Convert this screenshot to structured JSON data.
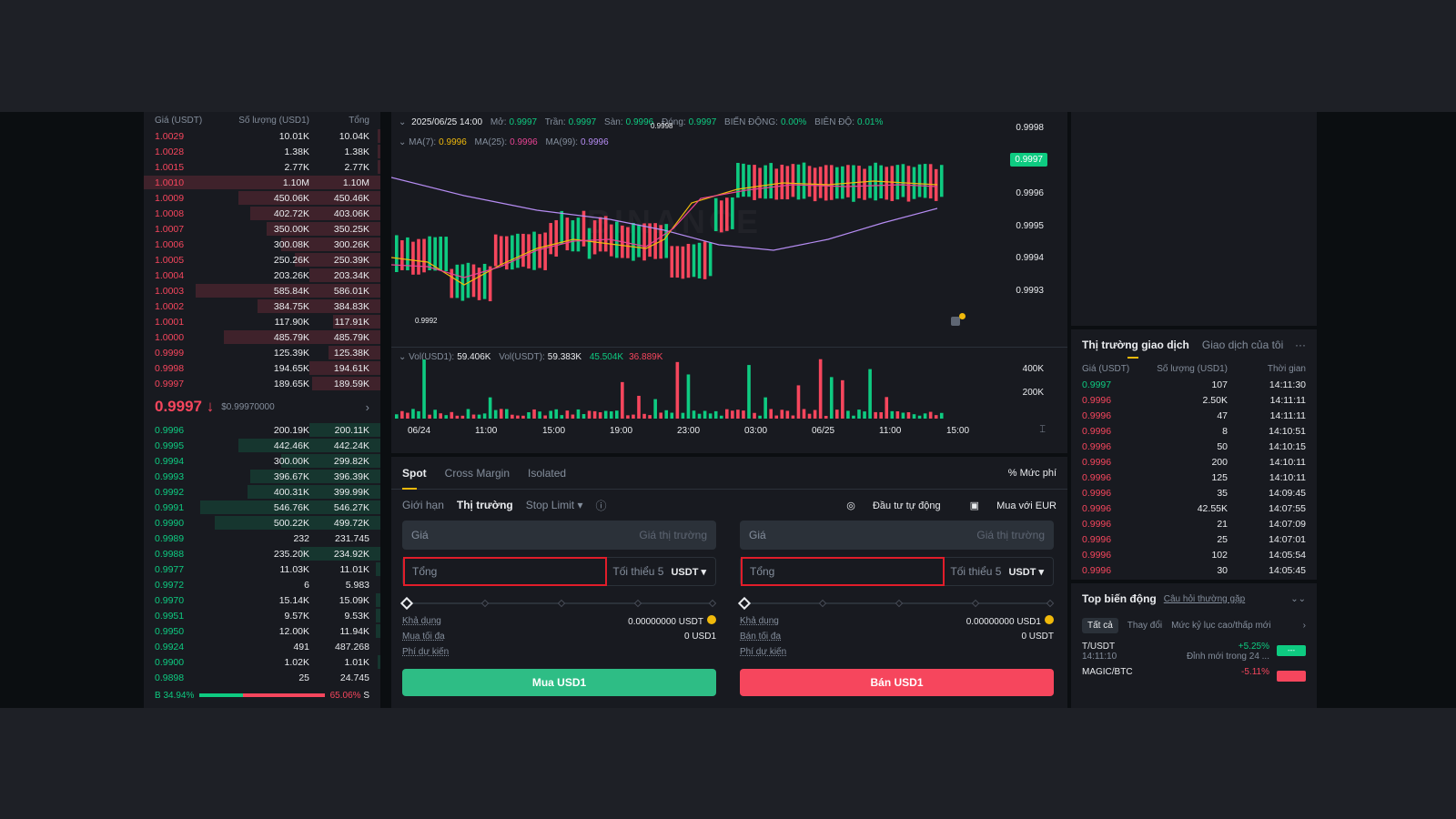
{
  "orderbook": {
    "headers": {
      "price": "Giá (USDT)",
      "qty": "Số lượng (USD1)",
      "total": "Tổng"
    },
    "asks": [
      {
        "p": "1.0029",
        "q": "10.01K",
        "t": "10.04K",
        "d": 0.01
      },
      {
        "p": "1.0028",
        "q": "1.38K",
        "t": "1.38K",
        "d": 0.01
      },
      {
        "p": "1.0015",
        "q": "2.77K",
        "t": "2.77K",
        "d": 0.01
      },
      {
        "p": "1.0010",
        "q": "1.10M",
        "t": "1.10M",
        "d": 1.0
      },
      {
        "p": "1.0009",
        "q": "450.06K",
        "t": "450.46K",
        "d": 0.6
      },
      {
        "p": "1.0008",
        "q": "402.72K",
        "t": "403.06K",
        "d": 0.55
      },
      {
        "p": "1.0007",
        "q": "350.00K",
        "t": "350.25K",
        "d": 0.48
      },
      {
        "p": "1.0006",
        "q": "300.08K",
        "t": "300.26K",
        "d": 0.42
      },
      {
        "p": "1.0005",
        "q": "250.26K",
        "t": "250.39K",
        "d": 0.36
      },
      {
        "p": "1.0004",
        "q": "203.26K",
        "t": "203.34K",
        "d": 0.3
      },
      {
        "p": "1.0003",
        "q": "585.84K",
        "t": "586.01K",
        "d": 0.78
      },
      {
        "p": "1.0002",
        "q": "384.75K",
        "t": "384.83K",
        "d": 0.52
      },
      {
        "p": "1.0001",
        "q": "117.90K",
        "t": "117.91K",
        "d": 0.2
      },
      {
        "p": "1.0000",
        "q": "485.79K",
        "t": "485.79K",
        "d": 0.66
      },
      {
        "p": "0.9999",
        "q": "125.39K",
        "t": "125.38K",
        "d": 0.22
      },
      {
        "p": "0.9998",
        "q": "194.65K",
        "t": "194.61K",
        "d": 0.3
      },
      {
        "p": "0.9997",
        "q": "189.65K",
        "t": "189.59K",
        "d": 0.29
      }
    ],
    "mid": {
      "last": "0.9997",
      "arrow": "↓",
      "usd": "$0.99970000",
      "chevron": "›"
    },
    "bids": [
      {
        "p": "0.9996",
        "q": "200.19K",
        "t": "200.11K",
        "d": 0.3
      },
      {
        "p": "0.9995",
        "q": "442.46K",
        "t": "442.24K",
        "d": 0.6
      },
      {
        "p": "0.9994",
        "q": "300.00K",
        "t": "299.82K",
        "d": 0.42
      },
      {
        "p": "0.9993",
        "q": "396.67K",
        "t": "396.39K",
        "d": 0.55
      },
      {
        "p": "0.9992",
        "q": "400.31K",
        "t": "399.99K",
        "d": 0.56
      },
      {
        "p": "0.9991",
        "q": "546.76K",
        "t": "546.27K",
        "d": 0.76
      },
      {
        "p": "0.9990",
        "q": "500.22K",
        "t": "499.72K",
        "d": 0.7
      },
      {
        "p": "0.9989",
        "q": "232",
        "t": "231.745",
        "d": 0.0
      },
      {
        "p": "0.9988",
        "q": "235.20K",
        "t": "234.92K",
        "d": 0.34
      },
      {
        "p": "0.9977",
        "q": "11.03K",
        "t": "11.01K",
        "d": 0.02
      },
      {
        "p": "0.9972",
        "q": "6",
        "t": "5.983",
        "d": 0.0
      },
      {
        "p": "0.9970",
        "q": "15.14K",
        "t": "15.09K",
        "d": 0.02
      },
      {
        "p": "0.9951",
        "q": "9.57K",
        "t": "9.53K",
        "d": 0.02
      },
      {
        "p": "0.9950",
        "q": "12.00K",
        "t": "11.94K",
        "d": 0.02
      },
      {
        "p": "0.9924",
        "q": "491",
        "t": "487.268",
        "d": 0.0
      },
      {
        "p": "0.9900",
        "q": "1.02K",
        "t": "1.01K",
        "d": 0.01
      },
      {
        "p": "0.9898",
        "q": "25",
        "t": "24.745",
        "d": 0.0
      }
    ],
    "ratio": {
      "b_label": "B",
      "b_pct": "34.94%",
      "s_pct": "65.06%",
      "s_label": "S",
      "b_value": 34.94
    }
  },
  "chart": {
    "ohlc": {
      "date": "2025/06/25 14:00",
      "open_k": "Mở:",
      "open": "0.9997",
      "high_k": "Trần:",
      "high": "0.9997",
      "low_k": "Sàn:",
      "low": "0.9996",
      "close_k": "Đóng:",
      "close": "0.9997",
      "chg_k": "BIẾN ĐỘNG:",
      "chg": "0.00%",
      "amp_k": "BIÊN ĐỘ:",
      "amp": "0.01%"
    },
    "ma": {
      "k1": "MA(7):",
      "v1": "0.9996",
      "k2": "MA(25):",
      "v2": "0.9996",
      "k3": "MA(99):",
      "v3": "0.9996"
    },
    "y_ticks": [
      "0.9998",
      "0.9996",
      "0.9995",
      "0.9994",
      "0.9993"
    ],
    "price_tag": "0.9997",
    "high_mark": "0.9998",
    "low_mark": "0.9992",
    "watermark": "BINANCE",
    "vol": {
      "k1": "Vol(USD1):",
      "v1": "59.406K",
      "k2": "Vol(USDT):",
      "v2": "59.383K",
      "v3": "45.504K",
      "v4": "36.889K"
    },
    "vol_ticks": [
      "400K",
      "200K"
    ],
    "x_ticks": [
      "06/24",
      "11:00",
      "15:00",
      "19:00",
      "23:00",
      "03:00",
      "06/25",
      "11:00",
      "15:00"
    ],
    "colors": {
      "up": "#0ecb81",
      "down": "#f6465d",
      "ma7": "#f0b90b",
      "ma25": "#e84393",
      "ma99": "#b58cf2"
    }
  },
  "form": {
    "tabs": [
      "Spot",
      "Cross Margin",
      "Isolated"
    ],
    "fee": "Mức phí",
    "order_types": [
      "Giới hạn",
      "Thị trường",
      "Stop Limit ▾"
    ],
    "auto_invest": "Đầu tư tự động",
    "buy_eur": "Mua với EUR",
    "buy": {
      "price_label": "Giá",
      "price_value": "Giá thị trường",
      "total_label": "Tổng",
      "min": "Tối thiểu 5",
      "unit": "USDT ▾",
      "avail_k": "Khả dụng",
      "avail_v": "0.00000000 USDT",
      "max_k": "Mua tối đa",
      "max_v": "0 USD1",
      "fee_k": "Phí dự kiến",
      "button": "Mua USD1"
    },
    "sell": {
      "price_label": "Giá",
      "price_value": "Giá thị trường",
      "total_label": "Tổng",
      "min": "Tối thiểu 5",
      "unit": "USDT ▾",
      "avail_k": "Khả dụng",
      "avail_v": "0.00000000 USD1",
      "max_k": "Bán tối đa",
      "max_v": "0 USDT",
      "fee_k": "Phí dự kiến",
      "button": "Bán USD1"
    }
  },
  "trades": {
    "tab_market": "Thị trường giao dịch",
    "tab_mine": "Giao dịch của tôi",
    "more": "···",
    "headers": {
      "price": "Giá (USDT)",
      "qty": "Số lượng (USD1)",
      "time": "Thời gian"
    },
    "rows": [
      {
        "p": "0.9997",
        "q": "107",
        "t": "14:11:30",
        "up": true
      },
      {
        "p": "0.9996",
        "q": "2.50K",
        "t": "14:11:11",
        "up": false
      },
      {
        "p": "0.9996",
        "q": "47",
        "t": "14:11:11",
        "up": false
      },
      {
        "p": "0.9996",
        "q": "8",
        "t": "14:10:51",
        "up": false
      },
      {
        "p": "0.9996",
        "q": "50",
        "t": "14:10:15",
        "up": false
      },
      {
        "p": "0.9996",
        "q": "200",
        "t": "14:10:11",
        "up": false
      },
      {
        "p": "0.9996",
        "q": "125",
        "t": "14:10:11",
        "up": false
      },
      {
        "p": "0.9996",
        "q": "35",
        "t": "14:09:45",
        "up": false
      },
      {
        "p": "0.9996",
        "q": "42.55K",
        "t": "14:07:55",
        "up": false
      },
      {
        "p": "0.9996",
        "q": "21",
        "t": "14:07:09",
        "up": false
      },
      {
        "p": "0.9996",
        "q": "25",
        "t": "14:07:01",
        "up": false
      },
      {
        "p": "0.9996",
        "q": "102",
        "t": "14:05:54",
        "up": false
      },
      {
        "p": "0.9996",
        "q": "30",
        "t": "14:05:45",
        "up": false
      }
    ]
  },
  "movers": {
    "title": "Top biến động",
    "faq": "Câu hỏi thường gặp",
    "expand": "⌄⌄",
    "filters": [
      "Tất cả",
      "Thay đổi",
      "Mức kỷ lục cao/thấp mới"
    ],
    "arrow": "›",
    "rows": [
      {
        "sym": "T/USDT",
        "time": "14:11:10",
        "pct": "+5.25%",
        "desc": "Đỉnh mới trong 24 ...",
        "up": true,
        "badge": "---"
      },
      {
        "sym": "MAGIC/BTC",
        "time": "",
        "pct": "-5.11%",
        "desc": "",
        "up": false,
        "badge": ""
      }
    ]
  }
}
